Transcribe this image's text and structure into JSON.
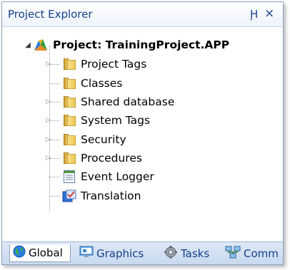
{
  "panel": {
    "title": "Project Explorer",
    "pin_glyph": "Ḩ",
    "close_glyph": "×"
  },
  "tree": {
    "root_label": "Project: TrainingProject.APP",
    "items": [
      {
        "label": "Project Tags",
        "icon": "folder-icon",
        "expandable": true
      },
      {
        "label": "Classes",
        "icon": "folder-icon",
        "expandable": false
      },
      {
        "label": "Shared database",
        "icon": "folder-icon",
        "expandable": true
      },
      {
        "label": "System Tags",
        "icon": "folder-icon",
        "expandable": true
      },
      {
        "label": "Security",
        "icon": "folder-icon",
        "expandable": true
      },
      {
        "label": "Procedures",
        "icon": "folder-icon",
        "expandable": true
      },
      {
        "label": "Event Logger",
        "icon": "event-logger-icon",
        "expandable": false
      },
      {
        "label": "Translation",
        "icon": "translation-icon",
        "expandable": false
      }
    ]
  },
  "tabs": [
    {
      "label": "Global",
      "icon": "globe-icon",
      "active": true
    },
    {
      "label": "Graphics",
      "icon": "graphics-icon",
      "active": false
    },
    {
      "label": "Tasks",
      "icon": "tasks-icon",
      "active": false
    },
    {
      "label": "Comm",
      "icon": "comm-icon",
      "active": false
    }
  ],
  "colors": {
    "title_text": "#15428b",
    "folder": "#efc953",
    "tab_bar": "#c9d9ef"
  }
}
